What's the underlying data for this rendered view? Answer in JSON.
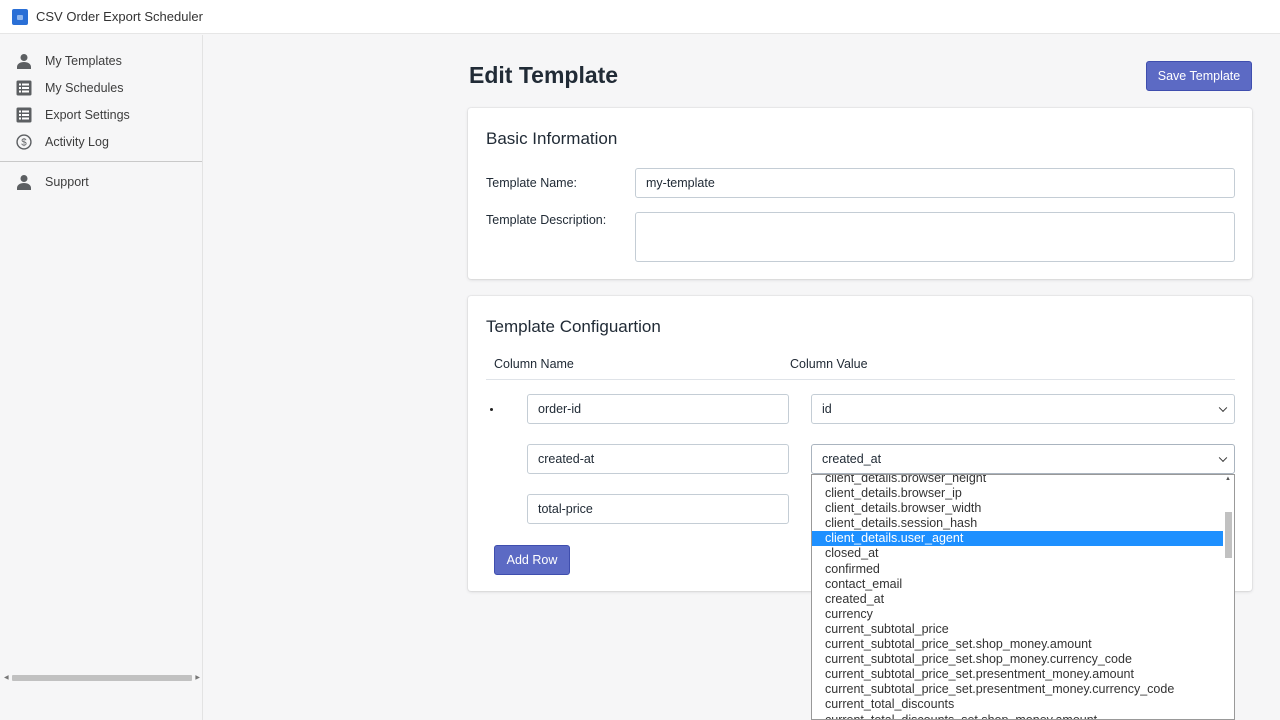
{
  "app": {
    "title": "CSV Order Export Scheduler"
  },
  "sidebar": {
    "items": [
      {
        "label": "My Templates",
        "icon": "person-icon"
      },
      {
        "label": "My Schedules",
        "icon": "list-icon"
      },
      {
        "label": "Export Settings",
        "icon": "list-icon"
      },
      {
        "label": "Activity Log",
        "icon": "dollar-circle-icon"
      }
    ],
    "support": {
      "label": "Support",
      "icon": "person-icon"
    }
  },
  "page": {
    "title": "Edit Template",
    "save_label": "Save Template"
  },
  "basic": {
    "title": "Basic Information",
    "name_label": "Template Name:",
    "name_value": "my-template",
    "desc_label": "Template Description:",
    "desc_value": ""
  },
  "config": {
    "title": "Template Configuartion",
    "col_name_header": "Column Name",
    "col_value_header": "Column Value",
    "rows": [
      {
        "name": "order-id",
        "value": "id"
      },
      {
        "name": "created-at",
        "value": "created_at"
      },
      {
        "name": "total-price",
        "value": ""
      }
    ],
    "add_row_label": "Add Row"
  },
  "dropdown": {
    "highlighted": "client_details.user_agent",
    "options": [
      "client_details.browser_height",
      "client_details.browser_ip",
      "client_details.browser_width",
      "client_details.session_hash",
      "client_details.user_agent",
      "closed_at",
      "confirmed",
      "contact_email",
      "created_at",
      "currency",
      "current_subtotal_price",
      "current_subtotal_price_set.shop_money.amount",
      "current_subtotal_price_set.shop_money.currency_code",
      "current_subtotal_price_set.presentment_money.amount",
      "current_subtotal_price_set.presentment_money.currency_code",
      "current_total_discounts",
      "current_total_discounts_set.shop_money.amount"
    ]
  },
  "colors": {
    "accent": "#5c6ac4",
    "highlight": "#1e90ff"
  }
}
